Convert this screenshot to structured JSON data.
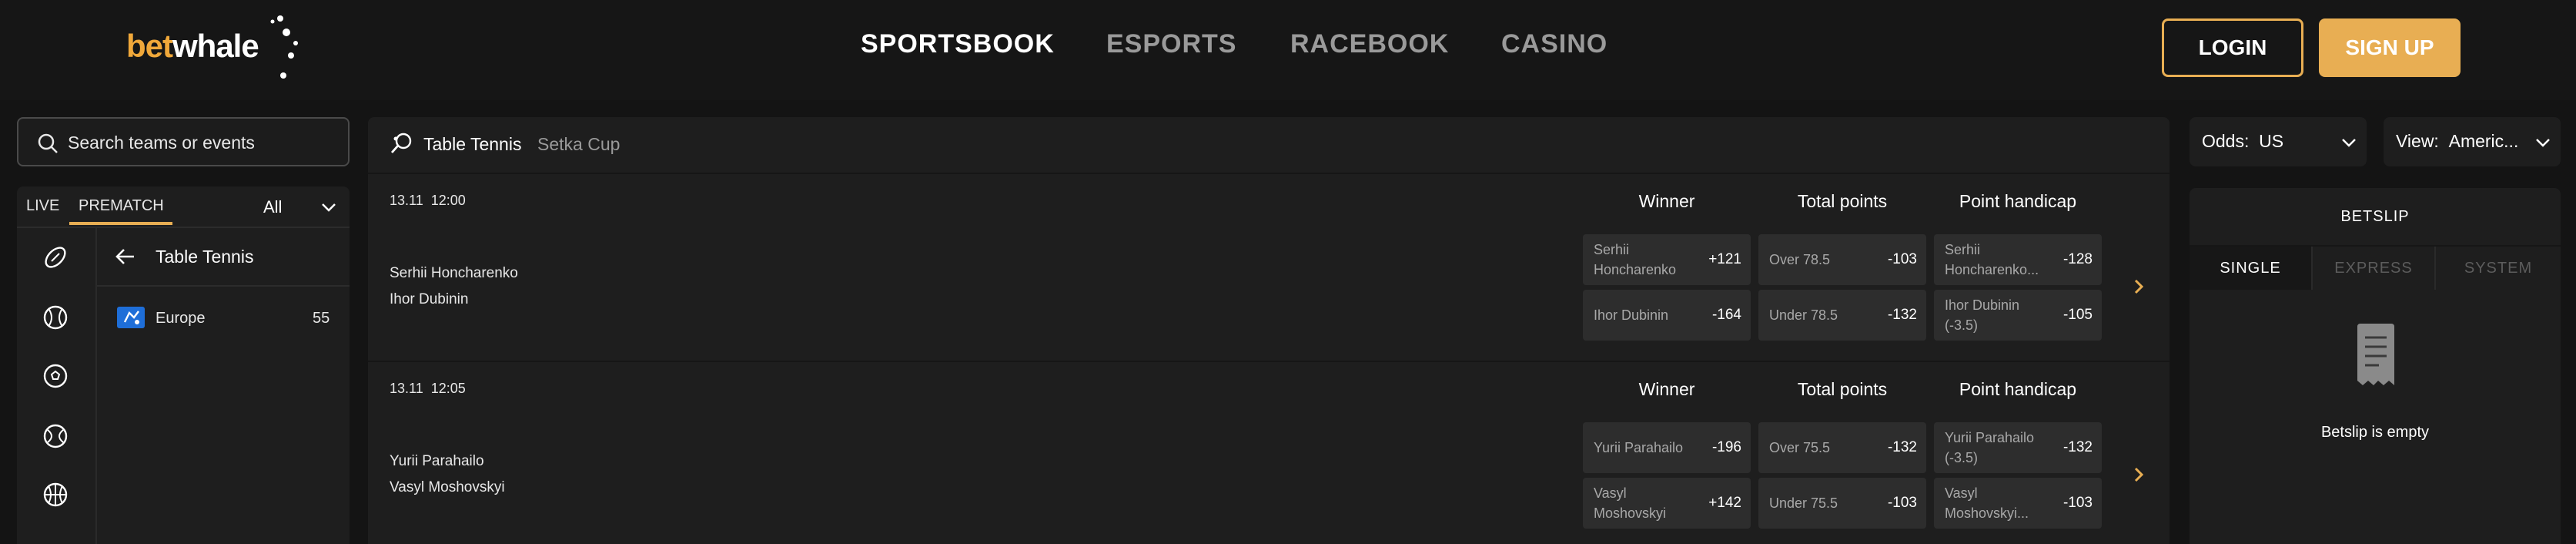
{
  "header": {
    "logo_part1": "bet",
    "logo_part2": "whale",
    "nav": [
      "SPORTSBOOK",
      "ESPORTS",
      "RACEBOOK",
      "CASINO"
    ],
    "login_label": "LOGIN",
    "signup_label": "SIGN UP"
  },
  "sidebar": {
    "search_placeholder": "Search teams or events",
    "tab_live": "LIVE",
    "tab_prematch": "PREMATCH",
    "filter_value": "All",
    "sport_icons": [
      "football-icon",
      "baseball-icon",
      "soccer-icon",
      "tennis-icon",
      "basketball-icon"
    ],
    "section_title": "Table Tennis",
    "regions": [
      {
        "name": "Europe",
        "count": "55"
      }
    ]
  },
  "main": {
    "sport": "Table Tennis",
    "league": "Setka Cup",
    "col_winner": "Winner",
    "col_total": "Total points",
    "col_handicap": "Point handicap",
    "matches": [
      {
        "date": "13.11",
        "time": "12:00",
        "team1": "Serhii Honcharenko",
        "team2": "Ihor Dubinin",
        "winner": [
          {
            "label": "Serhii Honcharenko",
            "odd": "+121"
          },
          {
            "label": "Ihor Dubinin",
            "odd": "-164"
          }
        ],
        "total": [
          {
            "label": "Over 78.5",
            "odd": "-103"
          },
          {
            "label": "Under 78.5",
            "odd": "-132"
          }
        ],
        "handicap": [
          {
            "label": "Serhii Honcharenko...",
            "odd": "-128"
          },
          {
            "label": "Ihor Dubinin (-3.5)",
            "odd": "-105"
          }
        ]
      },
      {
        "date": "13.11",
        "time": "12:05",
        "team1": "Yurii Parahailo",
        "team2": "Vasyl Moshovskyi",
        "winner": [
          {
            "label": "Yurii Parahailo",
            "odd": "-196"
          },
          {
            "label": "Vasyl Moshovskyi",
            "odd": "+142"
          }
        ],
        "total": [
          {
            "label": "Over 75.5",
            "odd": "-132"
          },
          {
            "label": "Under 75.5",
            "odd": "-103"
          }
        ],
        "handicap": [
          {
            "label": "Yurii Parahailo (-3.5)",
            "odd": "-132"
          },
          {
            "label": "Vasyl Moshovskyi...",
            "odd": "-103"
          }
        ]
      }
    ]
  },
  "right": {
    "odds_label": "Odds:",
    "odds_value": "US",
    "view_label": "View:",
    "view_value": "Americ...",
    "betslip_title": "BETSLIP",
    "tabs": [
      "SINGLE",
      "EXPRESS",
      "SYSTEM"
    ],
    "empty_text": "Betslip is empty"
  },
  "colors": {
    "accent": "#e8ae53",
    "background": "#141414",
    "panel": "#1e1e1e",
    "odd_box": "#2d2d2d"
  }
}
